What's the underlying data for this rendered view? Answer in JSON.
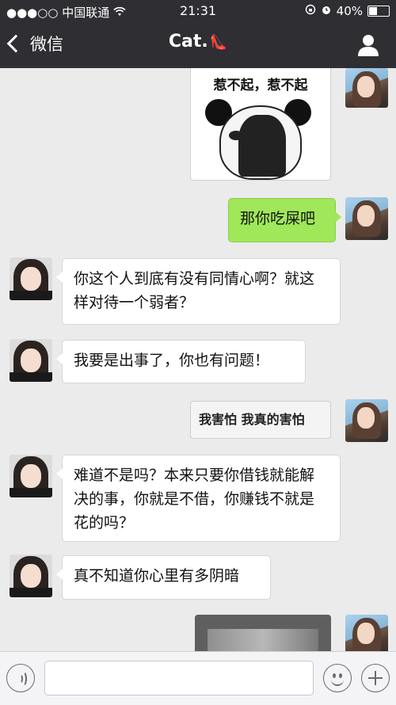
{
  "status_bar": {
    "signal": "●●●○○",
    "carrier": "中国联通",
    "wifi_icon": "wifi-icon",
    "time": "21:31",
    "battery": "40%",
    "battery_level": 0.4
  },
  "nav": {
    "back_label": "微信",
    "title": "Cat.",
    "title_emoji": "👠"
  },
  "messages": {
    "m1_sticker_caption": "惹不起，惹不起",
    "m2": "那你吃屎吧",
    "m3": "你这个人到底有没有同情心啊？就这样对待一个弱者？",
    "m4": "我要是出事了，你也有问题！",
    "m5": "我害怕 我真的害怕",
    "m6": "难道不是吗？本来只要你借钱就能解决的事，你就是不借，你赚钱不就是花的吗？",
    "m7": "真不知道你心里有多阴暗"
  },
  "colors": {
    "header": "#2e2e33",
    "chat_bg": "#ebebeb",
    "my_bubble": "#a0e75a",
    "their_bubble": "#ffffff"
  }
}
